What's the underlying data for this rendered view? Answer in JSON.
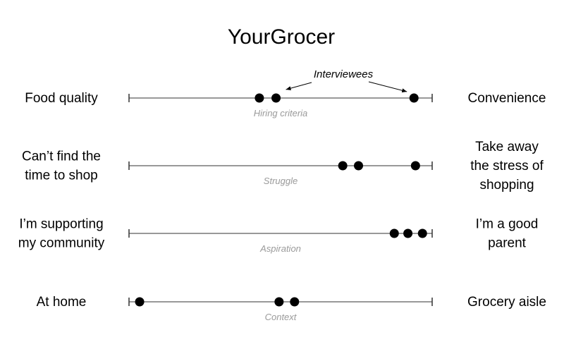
{
  "title": "YourGrocer",
  "callout": {
    "label": "Interviewees"
  },
  "scales": [
    {
      "left_label": [
        "Food quality"
      ],
      "right_label": [
        "Convenience"
      ],
      "dimension": "Hiring criteria",
      "interviewees": [
        0.43,
        0.485,
        0.94
      ]
    },
    {
      "left_label": [
        "Can’t find the",
        "time to shop"
      ],
      "right_label": [
        "Take away",
        "the stress of",
        "shopping"
      ],
      "dimension": "Struggle",
      "interviewees": [
        0.705,
        0.757,
        0.945
      ]
    },
    {
      "left_label": [
        "I’m supporting",
        "my community"
      ],
      "right_label": [
        "I’m a good",
        "parent"
      ],
      "dimension": "Aspiration",
      "interviewees": [
        0.875,
        0.92,
        0.968
      ]
    },
    {
      "left_label": [
        "At home"
      ],
      "right_label": [
        "Grocery aisle"
      ],
      "dimension": "Context",
      "interviewees": [
        0.035,
        0.495,
        0.546
      ]
    }
  ],
  "colors": {
    "ink": "#000000",
    "dimension_label": "#9a9a9a",
    "axis": "#333333"
  }
}
